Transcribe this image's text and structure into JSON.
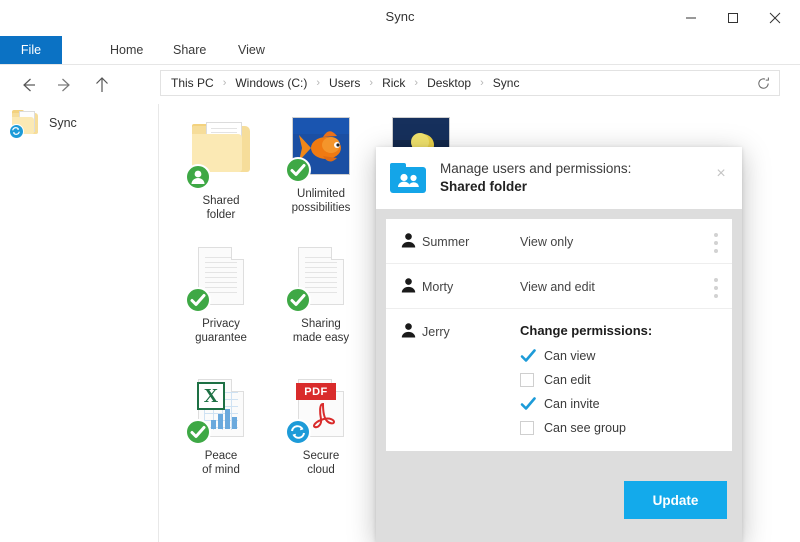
{
  "window": {
    "title": "Sync",
    "controls": {
      "minimize": "minimize-icon",
      "maximize": "maximize-icon",
      "close": "close-icon"
    }
  },
  "ribbon": {
    "tabs": [
      {
        "label": "File",
        "active": true
      },
      {
        "label": "Home",
        "active": false
      },
      {
        "label": "Share",
        "active": false
      },
      {
        "label": "View",
        "active": false
      }
    ],
    "file_tab_color": "#0b72c4"
  },
  "nav": {
    "back": "back-arrow-icon",
    "forward": "forward-arrow-icon",
    "up": "up-arrow-icon",
    "refresh": "refresh-icon",
    "breadcrumb": [
      "This PC",
      "Windows (C:)",
      "Users",
      "Rick",
      "Desktop",
      "Sync"
    ],
    "separator": "›"
  },
  "sidebar": {
    "items": [
      {
        "label": "Sync",
        "icon": "folder-icon",
        "badge": "sync-badge"
      }
    ]
  },
  "files": [
    {
      "name_line1": "Shared",
      "name_line2": "folder",
      "icon": "folder-icon",
      "badge": "shared-person-badge",
      "badge_color": "#3ea845"
    },
    {
      "name_line1": "Unlimited",
      "name_line2": "possibilities",
      "icon": "photo-goldfish-icon",
      "badge": "synced-check-badge",
      "badge_color": "#3ea845"
    },
    {
      "name_line1": "",
      "name_line2": "",
      "icon": "photo-night-icon",
      "badge": "",
      "badge_color": ""
    },
    {
      "name_line1": "Privacy",
      "name_line2": "guarantee",
      "icon": "document-icon",
      "badge": "synced-check-badge",
      "badge_color": "#3ea845"
    },
    {
      "name_line1": "Sharing",
      "name_line2": "made easy",
      "icon": "document-icon",
      "badge": "synced-check-badge",
      "badge_color": "#3ea845"
    },
    {
      "name_line1": "Peace",
      "name_line2": "of mind",
      "icon": "excel-file-icon",
      "badge": "synced-check-badge",
      "badge_color": "#3ea845",
      "glyph": "X"
    },
    {
      "name_line1": "Secure",
      "name_line2": "cloud",
      "icon": "pdf-file-icon",
      "badge": "sync-badge",
      "badge_color": "#1d9bd8",
      "label": "PDF"
    }
  ],
  "modal": {
    "icon": "shared-folder-people-icon",
    "heading": "Manage users and permissions:",
    "subject": "Shared folder",
    "close_label": "×",
    "users": [
      {
        "name": "Summer",
        "permission": "View only",
        "menu": "more-options-icon",
        "expanded": false
      },
      {
        "name": "Morty",
        "permission": "View and edit",
        "menu": "more-options-icon",
        "expanded": false
      },
      {
        "name": "Jerry",
        "permission": "",
        "menu": "",
        "expanded": true
      }
    ],
    "permissions_title": "Change permissions:",
    "permissions": [
      {
        "label": "Can view",
        "checked": true
      },
      {
        "label": "Can edit",
        "checked": false
      },
      {
        "label": "Can invite",
        "checked": true
      },
      {
        "label": "Can see group",
        "checked": false
      }
    ],
    "update_button": "Update",
    "accent_color": "#13aaeb",
    "checkbox_color": "#1d9bd8"
  }
}
